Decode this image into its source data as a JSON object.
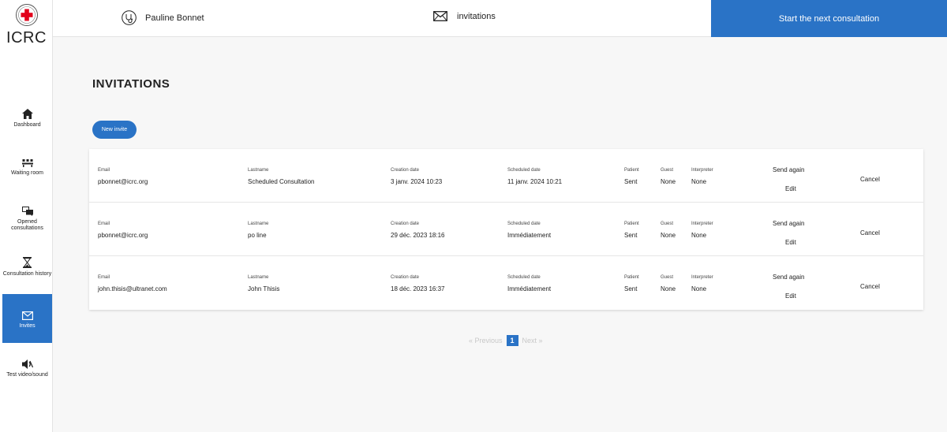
{
  "app": {
    "logo_text": "ICRC"
  },
  "sidebar": {
    "items": [
      {
        "label": "Dashboard",
        "icon": "home-icon"
      },
      {
        "label": "Waiting room",
        "icon": "waiting-room-icon"
      },
      {
        "label": "Opened consultations",
        "icon": "chat-icon"
      },
      {
        "label": "Consultation history",
        "icon": "hourglass-icon"
      },
      {
        "label": "Invites",
        "icon": "envelope-icon",
        "active": true
      },
      {
        "label": "Test video/sound",
        "icon": "speaker-icon"
      }
    ]
  },
  "header": {
    "user_name": "Pauline Bonnet",
    "invitations_label": "invitations",
    "start_button": "Start the next consultation"
  },
  "page": {
    "title": "INVITATIONS",
    "new_invite_button": "New invite"
  },
  "table": {
    "columns": {
      "email": "Email",
      "lastname": "Lastname",
      "creation": "Creation date",
      "scheduled": "Scheduled date",
      "patient": "Patient",
      "guest": "Guest",
      "interpreter": "Interpreter"
    },
    "actions": {
      "send_again": "Send again",
      "edit": "Edit",
      "cancel": "Cancel"
    },
    "rows": [
      {
        "email": "pbonnet@icrc.org",
        "lastname": "Scheduled Consultation",
        "creation": "3 janv. 2024 10:23",
        "scheduled": "11 janv. 2024 10:21",
        "patient": "Sent",
        "guest": "None",
        "interpreter": "None"
      },
      {
        "email": "pbonnet@icrc.org",
        "lastname": "po line",
        "creation": "29 déc. 2023 18:16",
        "scheduled": "Immédiatement",
        "patient": "Sent",
        "guest": "None",
        "interpreter": "None"
      },
      {
        "email": "john.thisis@ultranet.com",
        "lastname": "John Thisis",
        "creation": "18 déc. 2023 16:37",
        "scheduled": "Immédiatement",
        "patient": "Sent",
        "guest": "None",
        "interpreter": "None"
      }
    ]
  },
  "pagination": {
    "previous": "« Previous",
    "current": "1",
    "next": "Next »"
  },
  "colors": {
    "accent": "#2a73c6",
    "logo_red": "#e2001a"
  }
}
